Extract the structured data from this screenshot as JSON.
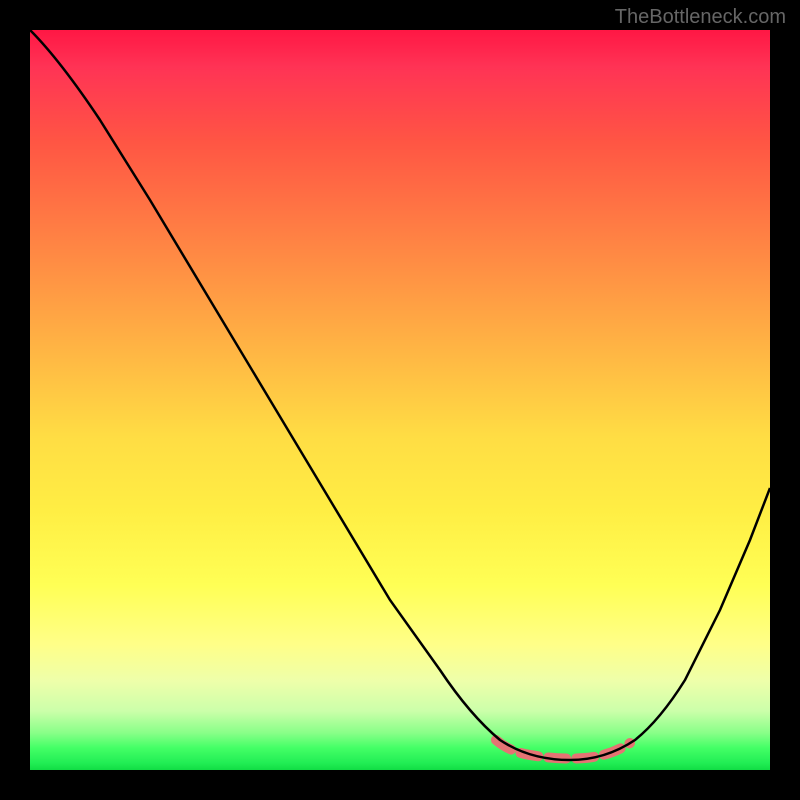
{
  "watermark": "TheBottleneck.com",
  "chart_data": {
    "type": "line",
    "title": "",
    "xlabel": "",
    "ylabel": "",
    "xlim": [
      0,
      100
    ],
    "ylim": [
      0,
      100
    ],
    "background": "rainbow-gradient",
    "series": [
      {
        "name": "bottleneck-curve",
        "x": [
          0,
          5,
          10,
          15,
          20,
          25,
          30,
          35,
          40,
          45,
          50,
          55,
          60,
          63,
          65,
          68,
          70,
          73,
          75,
          78,
          80,
          83,
          85,
          88,
          90,
          93,
          95,
          98,
          100
        ],
        "y": [
          100,
          97,
          93,
          88,
          80,
          72,
          64,
          56,
          48,
          40,
          32,
          24,
          16,
          11,
          8,
          5,
          3,
          1.5,
          1,
          1,
          1.2,
          2,
          4,
          8,
          13,
          20,
          28,
          37,
          46
        ]
      }
    ],
    "highlight": {
      "name": "optimal-range",
      "x_range": [
        63,
        82
      ],
      "y_value": 1.5,
      "style": "dashed-red"
    }
  }
}
